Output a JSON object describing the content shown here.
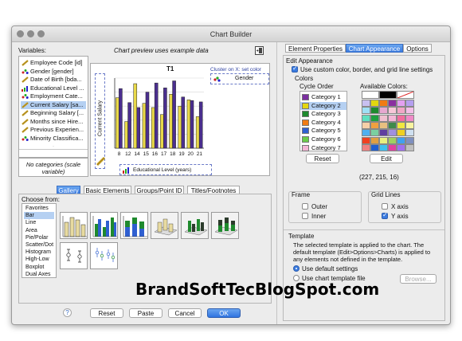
{
  "window": {
    "title": "Chart Builder"
  },
  "variables_panel": {
    "label": "Variables:",
    "items": [
      {
        "label": "Employee Code [id]",
        "type": "ruler"
      },
      {
        "label": "Gender [gender]",
        "type": "nominal"
      },
      {
        "label": "Date of Birth [bda...",
        "type": "ruler"
      },
      {
        "label": "Educational Level ...",
        "type": "ordinal"
      },
      {
        "label": "Employment Cate...",
        "type": "nominal"
      },
      {
        "label": "Current Salary [sa...",
        "type": "ruler",
        "selected": true
      },
      {
        "label": "Beginning Salary [...",
        "type": "ruler"
      },
      {
        "label": "Months since Hire...",
        "type": "ruler"
      },
      {
        "label": "Previous Experien...",
        "type": "ruler"
      },
      {
        "label": "Minority Classifica...",
        "type": "nominal"
      }
    ],
    "no_categories_line1": "No categories (scale",
    "no_categories_line2": "variable)"
  },
  "preview": {
    "note": "Chart preview uses example data",
    "chart_title": "T1",
    "cluster_label": "Cluster on X: set color",
    "legend_label": "Gender",
    "y_axis_title": "Current Salary",
    "x_axis_title": "Educational Level (years)"
  },
  "chart_data": {
    "type": "bar",
    "title": "T1",
    "xlabel": "Educational Level (years)",
    "ylabel": "Current Salary",
    "categories": [
      "8",
      "12",
      "14",
      "15",
      "16",
      "17",
      "18",
      "19",
      "20",
      "21"
    ],
    "series": [
      {
        "values": [
          0.72,
          0.38,
          0.92,
          0.64,
          0.58,
          0.48,
          0.77,
          0.6,
          0.69,
          0.45
        ]
      },
      {
        "values": [
          0.85,
          0.65,
          0.58,
          0.8,
          0.93,
          0.86,
          0.96,
          0.73,
          0.68,
          0.66
        ]
      }
    ],
    "series_colors": [
      "#e8d84a",
      "#4b2f8f"
    ],
    "ylim": [
      0,
      1
    ],
    "grid": true,
    "legend": "top-right"
  },
  "gallery_tabs": [
    {
      "label": "Gallery",
      "active": true
    },
    {
      "label": "Basic Elements"
    },
    {
      "label": "Groups/Point ID"
    },
    {
      "label": "Titles/Footnotes"
    }
  ],
  "gallery": {
    "choose_label": "Choose from:",
    "chart_types": [
      "Favorites",
      "Bar",
      "Line",
      "Area",
      "Pie/Polar",
      "Scatter/Dot",
      "Histogram",
      "High-Low",
      "Boxplot",
      "Dual Axes"
    ],
    "selected_index": 1
  },
  "buttons": {
    "help": "?",
    "reset": "Reset",
    "paste": "Paste",
    "cancel": "Cancel",
    "ok": "OK"
  },
  "right_tabs": [
    {
      "label": "Element Properties"
    },
    {
      "label": "Chart Appearance",
      "active": true
    },
    {
      "label": "Options"
    }
  ],
  "edit_appearance": {
    "group_label": "Edit Appearance",
    "use_custom_label": "Use custom color, border, and grid line settings",
    "use_custom_checked": true,
    "colors_label": "Colors",
    "cycle_order_label": "Cycle Order",
    "available_colors_label": "Available Colors:",
    "categories": [
      {
        "label": "Category 1",
        "color": "#7b2fa0"
      },
      {
        "label": "Category 2",
        "color": "#e3d70f",
        "selected": true
      },
      {
        "label": "Category 3",
        "color": "#1f8a2e"
      },
      {
        "label": "Category 4",
        "color": "#f07b13"
      },
      {
        "label": "Category 5",
        "color": "#2f5fd0"
      },
      {
        "label": "Category 6",
        "color": "#6acb4a"
      },
      {
        "label": "Category 7",
        "color": "#f4b6d6"
      }
    ],
    "reset_label": "Reset",
    "edit_label": "Edit",
    "rgb_readout": "(227, 215, 16)",
    "palette": [
      [
        "#ffffff",
        "#000000",
        "#ffffff"
      ],
      [
        "#c8c0f0",
        "#e3d70f",
        "#f07b13",
        "#8b2fa0",
        "#e3a0f0",
        "#b59fef"
      ],
      [
        "#9fe0f5",
        "#1f8a2e",
        "#e7a8d0",
        "#f7c7d8",
        "#f1a7c7",
        "#f3bfe8"
      ],
      [
        "#5fe0c0",
        "#1fa03f",
        "#f0c0d0",
        "#f4b6d6",
        "#f26e9f",
        "#f08ac7"
      ],
      [
        "#f7d0a8",
        "#f0a040",
        "#e8c080",
        "#3f8a4a",
        "#f0e840",
        "#f8f4a0"
      ],
      [
        "#4fb0f0",
        "#7bd0a0",
        "#5f3fa0",
        "#a090e0",
        "#f0d020",
        "#cfe0f0"
      ],
      [
        "#f04020",
        "#e0a040",
        "#e8f080",
        "#a0d060",
        "#40a0f0",
        "#7f90c0"
      ],
      [
        "#f08080",
        "#1f5fd0",
        "#40c0f0",
        "#e040a0",
        "#a070f0",
        "#c0c0c0"
      ]
    ]
  },
  "frame": {
    "label": "Frame",
    "outer": {
      "label": "Outer",
      "checked": false
    },
    "inner": {
      "label": "Inner",
      "checked": false
    }
  },
  "grid_lines": {
    "label": "Grid Lines",
    "x_axis": {
      "label": "X axis",
      "checked": false
    },
    "y_axis": {
      "label": "Y axis",
      "checked": true
    }
  },
  "template": {
    "label": "Template",
    "desc1": "The selected template is applied to the chart. The",
    "desc2": "default template (Edit>Options>Charts) is applied to",
    "desc3": "any elements not defined in the template.",
    "use_default": {
      "label": "Use default settings",
      "selected": true
    },
    "use_file": {
      "label": "Use chart template file",
      "selected": false
    },
    "browse_label": "Browse..."
  },
  "watermark": "BrandSoftTecBlogSpot.com"
}
